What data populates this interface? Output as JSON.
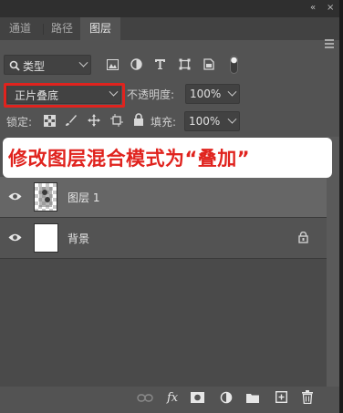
{
  "panel": {
    "collapse_label": "«",
    "close_label": "×"
  },
  "tabs": [
    {
      "label": "通道",
      "active": false
    },
    {
      "label": "路径",
      "active": false
    },
    {
      "label": "图层",
      "active": true
    }
  ],
  "filter": {
    "kind_label": "类型",
    "icons": [
      "image-filter-icon",
      "adjustment-filter-icon",
      "type-filter-icon",
      "shape-filter-icon",
      "smart-object-filter-icon",
      "filter-toggle-icon"
    ]
  },
  "blend": {
    "mode": "正片叠底",
    "opacity_label": "不透明度:",
    "opacity_value": "100%"
  },
  "lock": {
    "label": "锁定:",
    "icons": [
      "lock-transparent-pixels-icon",
      "lock-image-pixels-icon",
      "lock-position-icon",
      "prevent-auto-nesting-icon",
      "lock-all-icon"
    ],
    "fill_label": "填充:",
    "fill_value": "100%"
  },
  "callout": {
    "text": "修改图层混合模式为“叠加”"
  },
  "layers": [
    {
      "name": "图层 1",
      "visible": true,
      "selected": true,
      "thumbnail": "transparent"
    },
    {
      "name": "背景",
      "visible": true,
      "selected": false,
      "thumbnail": "white",
      "locked": true
    }
  ],
  "footer": {
    "icons": [
      "link-layers-icon",
      "layer-style-fx-icon",
      "add-mask-icon",
      "new-adjustment-layer-icon",
      "new-group-icon",
      "new-layer-icon",
      "delete-layer-icon"
    ],
    "fx_label": "fx"
  },
  "colors": {
    "panel_bg": "#535353",
    "selected_row": "#666666",
    "annotation_red": "#e0231e"
  }
}
